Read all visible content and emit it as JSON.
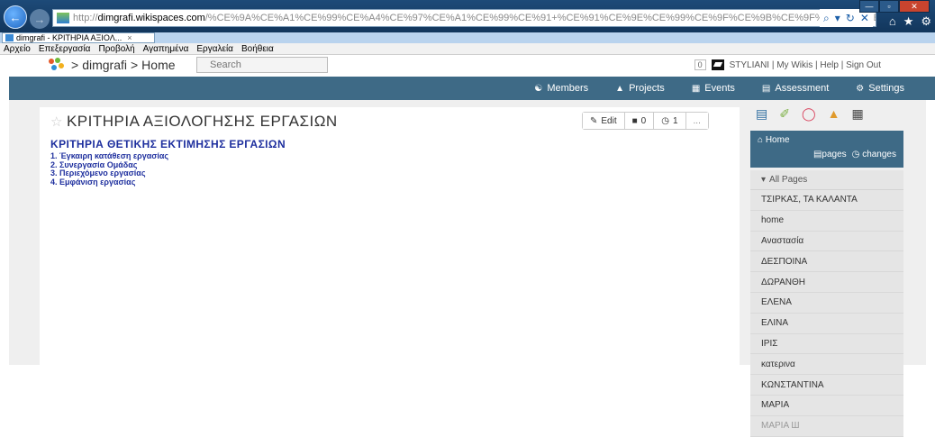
{
  "browser": {
    "address": {
      "scheme": "http://",
      "host": "dimgrafi.wikispaces.com",
      "path": "/%CE%9A%CE%A1%CE%99%CE%A4%CE%97%CE%A1%CE%99%CE%91+%CE%91%CE%9E%CE%99%CE%9F%CE%9B%CE%9F%CE%93%CE%97%CE%A3%CE%97%C"
    },
    "address_tools": [
      "⌕",
      "▾",
      "↻",
      "✕"
    ],
    "window_controls": [
      "—",
      "▫",
      "✕"
    ],
    "toolbar_icons": [
      "⌂",
      "★",
      "⚙"
    ],
    "tab": {
      "label": "dimgrafi - ΚΡΙΤΗΡΙΑ ΑΞΙΟΛ...",
      "close": "×"
    },
    "menu": [
      "Αρχείο",
      "Επεξεργασία",
      "Προβολή",
      "Αγαπημένα",
      "Εργαλεία",
      "Βοήθεια"
    ]
  },
  "site": {
    "breadcrumb": {
      "wiki": "dimgrafi",
      "separator": ">",
      "page": "Home"
    },
    "search_placeholder": "Search",
    "notification_count": "0",
    "user_links": "STYLIANI  |  My Wikis  |  Help  |  Sign Out"
  },
  "nav": {
    "members": "Members",
    "projects": "Projects",
    "events": "Events",
    "assessment": "Assessment",
    "settings": "Settings"
  },
  "page": {
    "title": "ΚΡΙΤΗΡΙΑ ΑΞΙΟΛΟΓΗΣΗΣ ΕΡΓΑΣΙΩΝ",
    "actions": {
      "edit": "Edit",
      "comments": "0",
      "history": "1",
      "more": "..."
    },
    "heading": "ΚΡΙΤΗΡΙΑ ΘΕΤΙΚΗΣ ΕΚΤΙΜΗΣΗΣ ΕΡΓΑΣΙΩΝ",
    "list": [
      "1. Έγκαιρη κατάθεση εργασίας",
      "2. Συνεργασία Ομάδας",
      "3. Περιεχόμενο εργασίας",
      "4. Εμφάνιση εργασίας"
    ]
  },
  "sidebar": {
    "home_label": "Home",
    "pages_link": "pages",
    "changes_link": "changes",
    "all_pages_label": "All Pages",
    "pages": [
      "ΤΣΙΡΚΑΣ, ΤΑ ΚΑΛΑΝΤΑ",
      "home",
      "Αναστασία",
      "ΔΕΣΠΟΙΝΑ",
      "ΔΩΡΑΝΘΗ",
      "ΕΛΕΝΑ",
      "ΕΛΙΝΑ",
      "ΙΡΙΣ",
      "κατερινα",
      "ΚΩΝΣΤΑΝΤΙΝΑ",
      "ΜΑΡΙΑ",
      "ΜΑΡΙΑ Ш"
    ]
  },
  "colors": {
    "nav_bar": "#3e6a86",
    "wiki_text": "#1e2f9e",
    "titlebar": "#1d4a78"
  }
}
